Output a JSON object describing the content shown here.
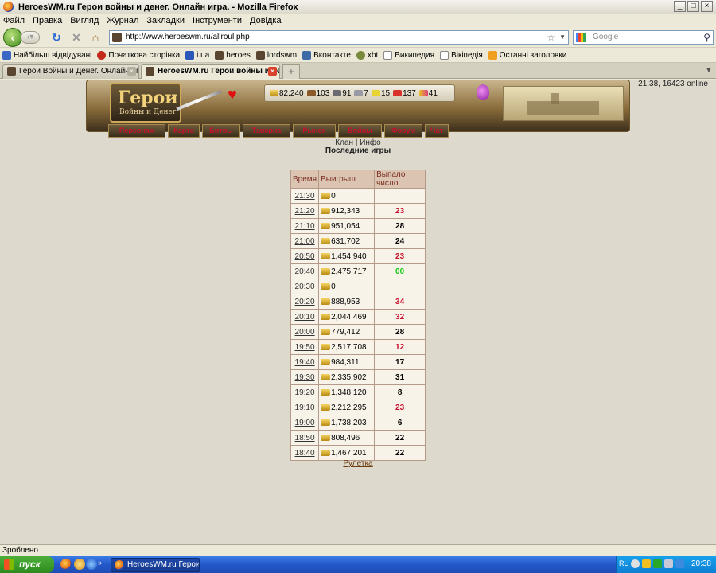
{
  "window": {
    "title": "HeroesWM.ru Герои войны и денег. Онлайн игра. - Mozilla Firefox",
    "minimize": "_",
    "maximize": "□",
    "close": "×"
  },
  "menu": [
    "Файл",
    "Правка",
    "Вигляд",
    "Журнал",
    "Закладки",
    "Інструменти",
    "Довідка"
  ],
  "toolbar": {
    "url": "http://www.heroeswm.ru/allroul.php",
    "search_placeholder": "Google"
  },
  "bookmarks": [
    "Найбільш відвідувані",
    "Початкова сторінка",
    "i.ua",
    "heroes",
    "lordswm",
    "Вконтакте",
    "xbt",
    "Википедия",
    "Вікіпедія",
    "Останні заголовки"
  ],
  "tabs": [
    {
      "label": "Герои Войны и Денег. Онлайн игра.",
      "active": false
    },
    {
      "label": "HeroesWM.ru Герои войны и ден...",
      "active": true
    }
  ],
  "page": {
    "online": "21:38, 16423 online",
    "logo_title": "Герои",
    "logo_subtitle": "Войны и Денег",
    "resources": [
      "82,240",
      "103",
      "91",
      "7",
      "15",
      "137",
      "41"
    ],
    "nav": [
      "Персонаж",
      "Карта",
      "Битвы",
      "Таверна",
      "Рынок",
      "Войны",
      "Форум",
      "Чат"
    ],
    "clan_link": "Клан",
    "separator": "|",
    "info_link": "Инфо",
    "section_title": "Последние игры",
    "table_headers": [
      "Время",
      "Выигрыш",
      "Выпало число"
    ],
    "games": [
      {
        "time": "21:30",
        "win": "0",
        "number": ""
      },
      {
        "time": "21:20",
        "win": "912,343",
        "number": "23"
      },
      {
        "time": "21:10",
        "win": "951,054",
        "number": "28"
      },
      {
        "time": "21:00",
        "win": "631,702",
        "number": "24"
      },
      {
        "time": "20:50",
        "win": "1,454,940",
        "number": "23"
      },
      {
        "time": "20:40",
        "win": "2,475,717",
        "number": "00"
      },
      {
        "time": "20:30",
        "win": "0",
        "number": ""
      },
      {
        "time": "20:20",
        "win": "888,953",
        "number": "34"
      },
      {
        "time": "20:10",
        "win": "2,044,469",
        "number": "32"
      },
      {
        "time": "20:00",
        "win": "779,412",
        "number": "28"
      },
      {
        "time": "19:50",
        "win": "2,517,708",
        "number": "12"
      },
      {
        "time": "19:40",
        "win": "984,311",
        "number": "17"
      },
      {
        "time": "19:30",
        "win": "2,335,902",
        "number": "31"
      },
      {
        "time": "19:20",
        "win": "1,348,120",
        "number": "8"
      },
      {
        "time": "19:10",
        "win": "2,212,295",
        "number": "23"
      },
      {
        "time": "19:00",
        "win": "1,738,203",
        "number": "6"
      },
      {
        "time": "18:50",
        "win": "808,496",
        "number": "22"
      },
      {
        "time": "18:40",
        "win": "1,467,201",
        "number": "22"
      }
    ],
    "roulette_link": "Рулетка"
  },
  "colors": {
    "red": "#c8102e",
    "black": "#000000",
    "green": "#12c812"
  },
  "status": "Зроблено",
  "taskbar": {
    "start": "пуск",
    "item": "HeroesWM.ru Герои ...",
    "lang": "RL",
    "clock": "20:38"
  }
}
